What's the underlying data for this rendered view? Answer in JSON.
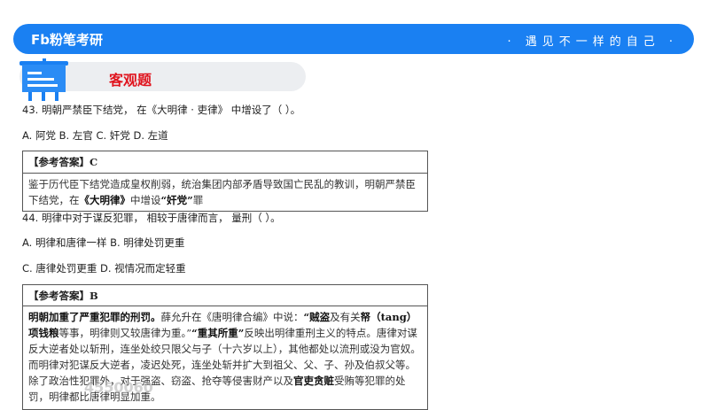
{
  "header": {
    "logo": "Fb粉笔考研",
    "slogan": "· 遇见不一样的自己 ·"
  },
  "section": {
    "title": "客观题"
  },
  "q43": {
    "stem": "43. 明朝严禁臣下结党， 在《大明律 · 吏律》 中增设了（ ）。",
    "options": "A. 阿党 B. 左官 C. 奸党 D. 左道",
    "answer": "【参考答案】C",
    "explain_a": "鉴于历代臣下结党造成皇权削弱，统治集团内部矛盾导致国亡民乱的教训，明朝严禁臣下结党，在",
    "explain_b": "《大明律》",
    "explain_c": "中增设",
    "explain_d": "“奸党”",
    "explain_e": "罪"
  },
  "q44": {
    "stem": "44. 明律中对于谋反犯罪， 相较于唐律而言， 量刑（ ）。",
    "options1": "A. 明律和唐律一样 B. 明律处罚更重",
    "options2": "C. 唐律处罚更重 D. 视情况而定轻重",
    "answer": "【参考答案】B",
    "e1": "明朝加重了严重犯罪的刑罚。",
    "e2": "薛允升在《唐明律合编》中说：",
    "e3": "“贼盗",
    "e4": "及有关",
    "e5": "帑（tang）项钱粮",
    "e6": "等事，明律则又较唐律为重。”",
    "e7": "“重其所重”",
    "e8": "反映出明律重刑主义的特点。唐律对谋反大逆者处以斩刑，连坐处绞只限父与子（十六岁以上），其他都处以流刑或没为官奴。而明律对犯谋反大逆者，凌迟处死，连坐处斩并扩大到祖父、父、子、孙及伯叔父等。除了政治性犯罪外，对于强盗、窃盗、抢夺等侵害财产以及",
    "e9": "官吏贪赃",
    "e10": "受贿等犯罪的处罚，明律都比唐律明显加重。"
  },
  "watermark": "4550060"
}
